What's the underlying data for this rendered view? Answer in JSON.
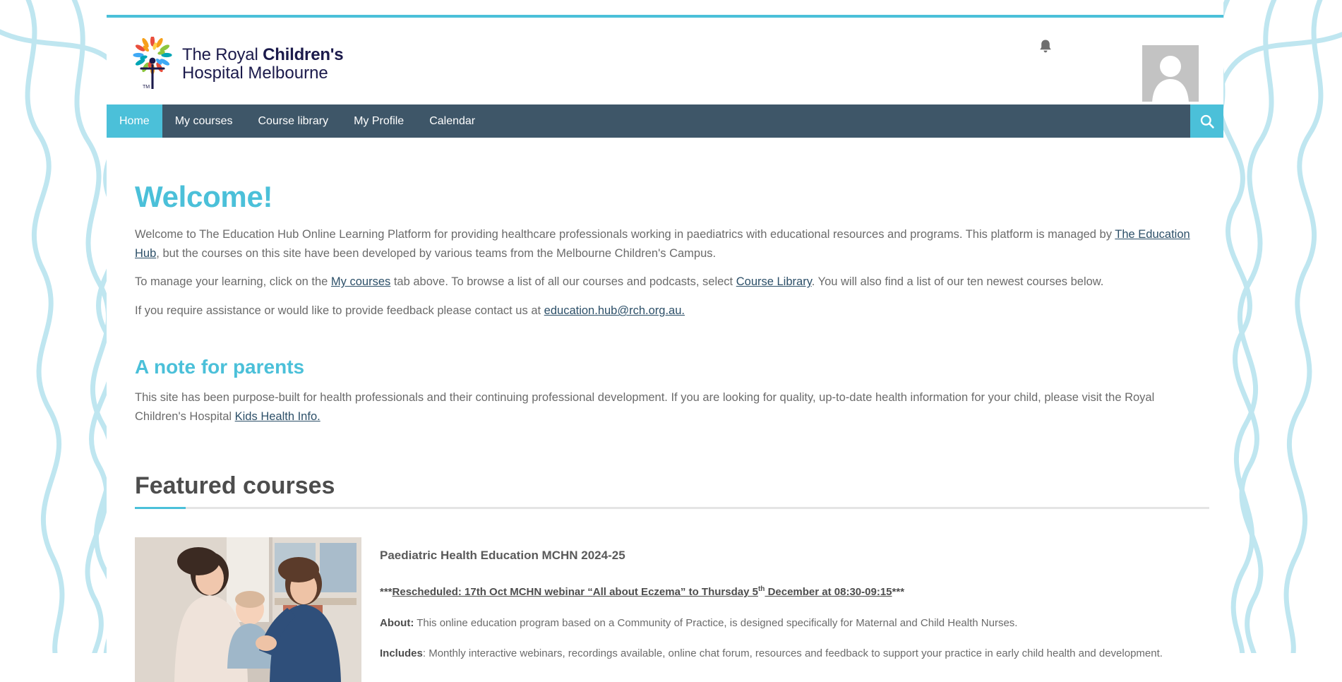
{
  "brand": {
    "logo_line1_prefix": "The Royal ",
    "logo_line1_bold": "Children's",
    "logo_line2": "Hospital Melbourne",
    "accent_color": "#4bc0d9",
    "nav_bg_color": "#3e5668",
    "heading_color": "#4bc0d9",
    "body_text_color": "#6b6b6b",
    "link_color": "#2c4f68"
  },
  "header": {
    "bell_icon": "notification-bell-icon",
    "avatar_icon": "default-user-avatar"
  },
  "nav": {
    "items": [
      {
        "label": "Home",
        "active": true
      },
      {
        "label": "My courses",
        "active": false
      },
      {
        "label": "Course library",
        "active": false
      },
      {
        "label": "My Profile",
        "active": false
      },
      {
        "label": "Calendar",
        "active": false
      }
    ],
    "search_icon": "search-icon"
  },
  "welcome": {
    "heading": "Welcome!",
    "para1_a": "Welcome to The Education Hub Online Learning Platform for providing healthcare professionals working in paediatrics with educational resources and programs. This platform is managed by ",
    "para1_link": "The Education Hub",
    "para1_b": ", but the courses on this site have been developed by various teams from the Melbourne Children's Campus.",
    "para2_a": "To manage your learning, click on the ",
    "para2_link1": "My courses",
    "para2_b": " tab above. To browse a list of all our courses and podcasts, select ",
    "para2_link2": "Course Library",
    "para2_c": ". You will also find a list of our ten newest courses below.",
    "para3_a": "If you require assistance or would like to provide feedback please contact us at ",
    "para3_link": "education.hub@rch.org.au."
  },
  "parents": {
    "heading": "A note for parents",
    "para_a": "This site has been purpose-built for health professionals and their continuing professional development.  If you are looking for quality, up-to-date health information for your child, please visit the Royal Children's Hospital ",
    "para_link": "Kids Health Info."
  },
  "featured": {
    "heading": "Featured courses",
    "course": {
      "title": "Paediatric Health Education MCHN 2024-25",
      "thumb_alt": "two-women-holding-baby-photo",
      "reschedule_stars_open": "***",
      "reschedule_text_1": "Rescheduled: 17th Oct MCHN webinar “All about Eczema” to Thursday 5",
      "reschedule_sup": "th",
      "reschedule_text_2": " December at 08:30-09:15",
      "reschedule_stars_close": "***",
      "about_label": "About:",
      "about_text": "  This online education program based on a Community of Practice, is designed specifically for Maternal and Child Health Nurses.",
      "includes_label": "Includes",
      "includes_text": ": Monthly interactive webinars, recordings available, online chat forum, resources and feedback to support your practice in early child health and development."
    }
  }
}
